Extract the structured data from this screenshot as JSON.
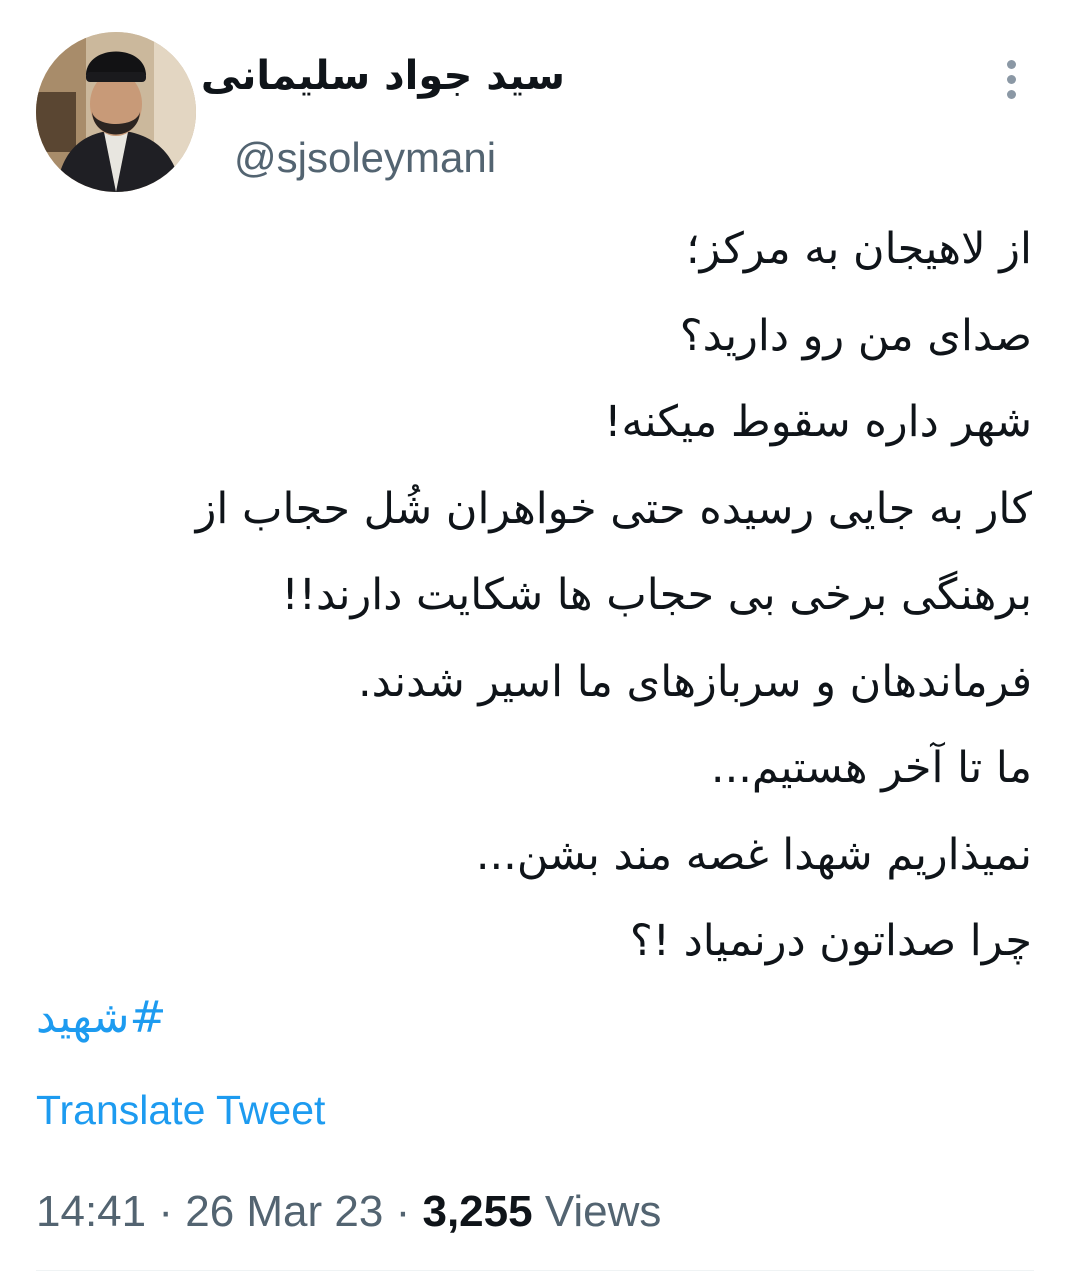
{
  "author": {
    "display_name": "سید جواد سلیمانی",
    "handle": "@sjsoleymani",
    "avatar_icon": "user-portrait-icon"
  },
  "menu": {
    "icon": "more-vertical-icon"
  },
  "tweet": {
    "lines": [
      "از لاهیجان به مرکز؛",
      "صدای من رو دارید؟",
      "شهر داره سقوط میکنه!",
      "کار به جایی رسیده حتی خواهران شُل حجاب از",
      "برهنگی برخی بی حجاب ها شکایت دارند!!",
      "فرماندهان و سربازهای ما اسیر شدند.",
      "ما تا آخر هستیم...",
      "نمیذاریم شهدا غصه مند بشن...",
      "چرا صداتون درنمیاد !؟"
    ],
    "hashtag": "#شهید",
    "translate_label": "Translate Tweet"
  },
  "meta": {
    "time": "14:41",
    "separator1": "·",
    "date": "26 Mar 23",
    "separator2": "·",
    "views_count": "3,255",
    "views_label": "Views"
  },
  "colors": {
    "link": "#1d9bf0",
    "secondary_text": "#536471",
    "primary_text": "#0f1419"
  }
}
